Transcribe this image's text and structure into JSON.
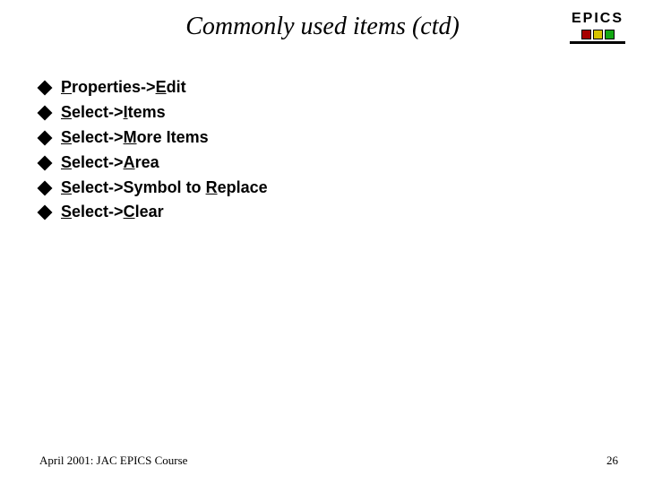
{
  "header": {
    "title": "Commonly used items (ctd)",
    "logo_text": "EPICS",
    "logo_colors": [
      "#a60000",
      "#d6c400",
      "#13a813"
    ]
  },
  "items": [
    [
      [
        "u",
        "P"
      ],
      [
        "",
        "roperties->"
      ],
      [
        "u",
        "E"
      ],
      [
        "",
        "dit"
      ]
    ],
    [
      [
        "u",
        "S"
      ],
      [
        "",
        "elect->"
      ],
      [
        "u",
        "I"
      ],
      [
        "",
        "tems"
      ]
    ],
    [
      [
        "u",
        "S"
      ],
      [
        "",
        "elect->"
      ],
      [
        "u",
        "M"
      ],
      [
        "",
        "ore Items"
      ]
    ],
    [
      [
        "u",
        "S"
      ],
      [
        "",
        "elect->"
      ],
      [
        "u",
        "A"
      ],
      [
        "",
        "rea"
      ]
    ],
    [
      [
        "u",
        "S"
      ],
      [
        "",
        "elect->Symbol to "
      ],
      [
        "u",
        "R"
      ],
      [
        "",
        "eplace"
      ]
    ],
    [
      [
        "u",
        "S"
      ],
      [
        "",
        "elect->"
      ],
      [
        "u",
        "C"
      ],
      [
        "",
        "lear"
      ]
    ]
  ],
  "footer": {
    "left": "April 2001: JAC EPICS Course",
    "right": "26"
  }
}
